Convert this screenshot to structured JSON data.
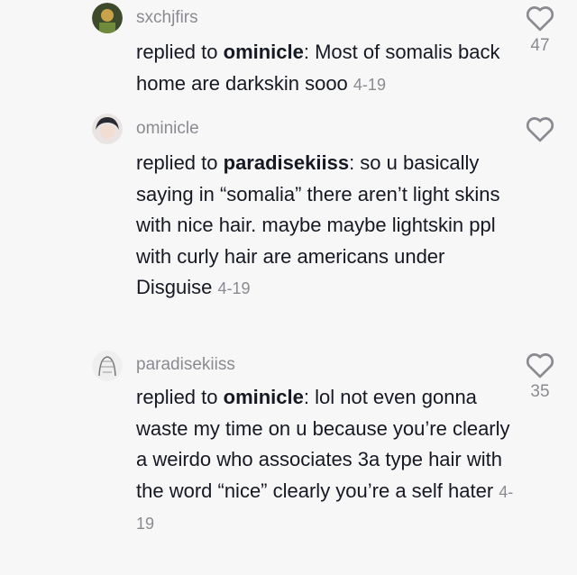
{
  "comments": [
    {
      "username": "sxchjfirs",
      "reply_prefix": "replied to ",
      "reply_to": "ominicle",
      "text": ": Most of somalis back home are darkskin sooo",
      "date": "4-19",
      "likes": "47"
    },
    {
      "username": "ominicle",
      "reply_prefix": "replied to ",
      "reply_to": "paradisekiiss",
      "text": ": so u basically saying in “somalia” there aren’t light skins with nice hair. maybe maybe lightskin ppl with curly hair are americans under Disguise",
      "date": "4-19",
      "likes": ""
    },
    {
      "username": "paradisekiiss",
      "reply_prefix": "replied to ",
      "reply_to": "ominicle",
      "text": ": lol not even gonna waste my time on u because you’re clearly a weirdo who associates 3a type hair with the word “nice” clearly you’re a self hater",
      "date": "4-19",
      "likes": "35"
    }
  ],
  "icons": {
    "like": "heart-outline-icon"
  },
  "colors": {
    "background": "#f7f7f7",
    "text": "#161823",
    "muted": "#8a8b91"
  }
}
